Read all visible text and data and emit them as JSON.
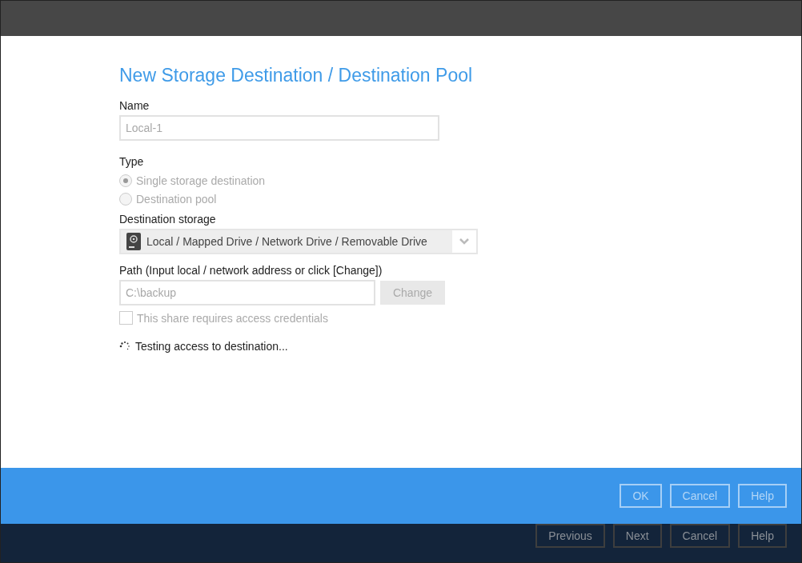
{
  "title": "New Storage Destination / Destination Pool",
  "name_field": {
    "label": "Name",
    "value": "Local-1",
    "disabled": true
  },
  "type": {
    "label": "Type",
    "disabled": true,
    "options": [
      {
        "label": "Single storage destination",
        "selected": true
      },
      {
        "label": "Destination pool",
        "selected": false
      }
    ]
  },
  "destination_storage": {
    "label": "Destination storage",
    "value": "Local / Mapped Drive / Network Drive / Removable Drive"
  },
  "path": {
    "label": "Path (Input local / network address or click [Change])",
    "value": "C:\\backup",
    "disabled": true,
    "button": "Change"
  },
  "credentials": {
    "label": "This share requires access credentials",
    "checked": false,
    "disabled": true
  },
  "status": "Testing access to destination...",
  "dialog_buttons": [
    "OK",
    "Cancel",
    "Help"
  ],
  "wizard_buttons": [
    "Previous",
    "Next",
    "Cancel",
    "Help"
  ]
}
